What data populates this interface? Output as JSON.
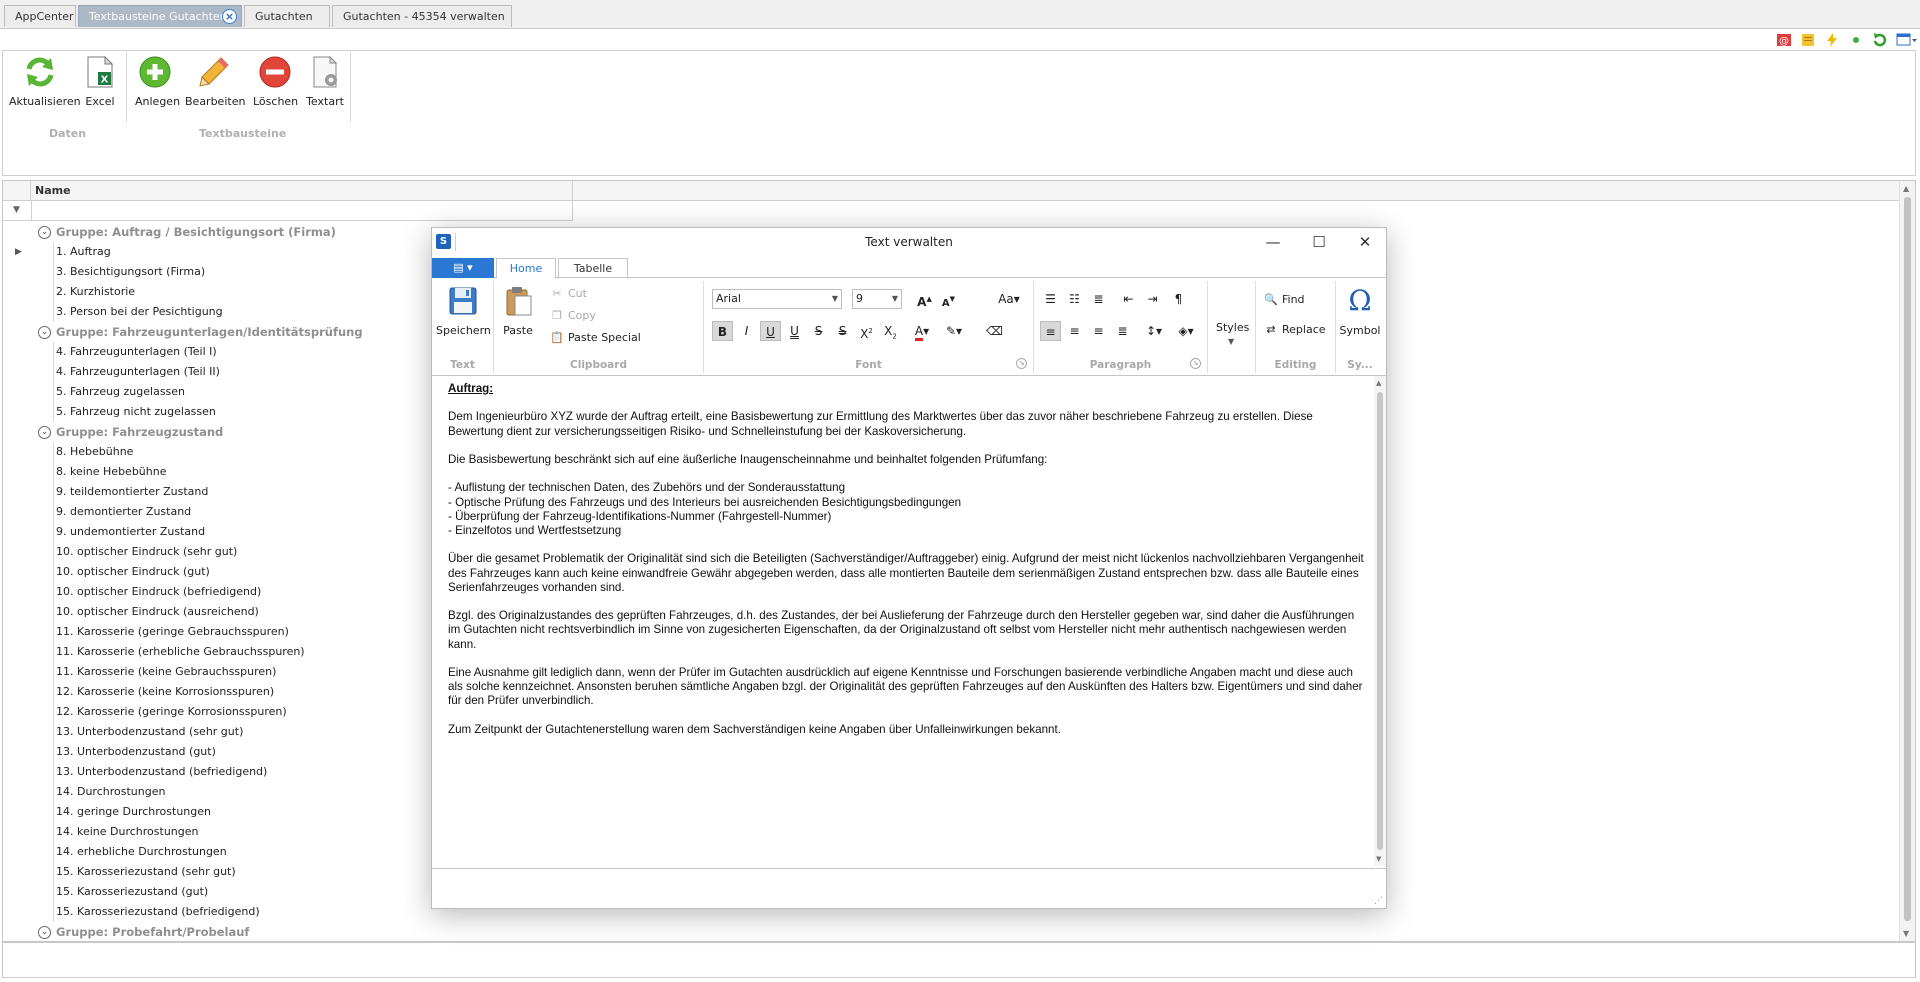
{
  "tabs": [
    {
      "label": "AppCenter",
      "active": false
    },
    {
      "label": "Textbausteine Gutachten",
      "active": true
    },
    {
      "label": "Gutachten",
      "active": false
    },
    {
      "label": "Gutachten - 45354 verwalten",
      "active": false
    }
  ],
  "ribbon": {
    "buttons": [
      "Aktualisieren",
      "Excel",
      "Anlegen",
      "Bearbeiten",
      "Löschen",
      "Textart"
    ],
    "group_daten": "Daten",
    "group_textbausteine": "Textbausteine"
  },
  "grid": {
    "column_name": "Name",
    "rows": [
      {
        "type": "group",
        "label": "Gruppe: Auftrag / Besichtigungsort (Firma)"
      },
      {
        "type": "item",
        "label": "1. Auftrag",
        "current": true
      },
      {
        "type": "item",
        "label": "3. Besichtigungsort (Firma)"
      },
      {
        "type": "item",
        "label": "2. Kurzhistorie"
      },
      {
        "type": "item",
        "label": "3. Person bei der Pesichtigung"
      },
      {
        "type": "group",
        "label": "Gruppe: Fahrzeugunterlagen/Identitätsprüfung"
      },
      {
        "type": "item",
        "label": "4. Fahrzeugunterlagen (Teil I)"
      },
      {
        "type": "item",
        "label": "4. Fahrzeugunterlagen (Teil II)"
      },
      {
        "type": "item",
        "label": "5. Fahrzeug zugelassen"
      },
      {
        "type": "item",
        "label": "5. Fahrzeug nicht zugelassen"
      },
      {
        "type": "group",
        "label": "Gruppe: Fahrzeugzustand"
      },
      {
        "type": "item",
        "label": "8. Hebebühne"
      },
      {
        "type": "item",
        "label": "8. keine Hebebühne"
      },
      {
        "type": "item",
        "label": "9. teildemontierter Zustand"
      },
      {
        "type": "item",
        "label": "9. demontierter Zustand"
      },
      {
        "type": "item",
        "label": "9. undemontierter Zustand"
      },
      {
        "type": "item",
        "label": "10. optischer Eindruck (sehr gut)"
      },
      {
        "type": "item",
        "label": "10. optischer Eindruck (gut)"
      },
      {
        "type": "item",
        "label": "10. optischer Eindruck (befriedigend)"
      },
      {
        "type": "item",
        "label": "10. optischer Eindruck (ausreichend)"
      },
      {
        "type": "item",
        "label": "11. Karosserie (geringe Gebrauchsspuren)"
      },
      {
        "type": "item",
        "label": "11. Karosserie (erhebliche Gebrauchsspuren)"
      },
      {
        "type": "item",
        "label": "11. Karosserie (keine Gebrauchsspuren)"
      },
      {
        "type": "item",
        "label": "12. Karosserie (keine Korrosionsspuren)"
      },
      {
        "type": "item",
        "label": "12. Karosserie (geringe Korrosionsspuren)"
      },
      {
        "type": "item",
        "label": "13. Unterbodenzustand (sehr gut)"
      },
      {
        "type": "item",
        "label": "13. Unterbodenzustand (gut)"
      },
      {
        "type": "item",
        "label": "13. Unterbodenzustand (befriedigend)"
      },
      {
        "type": "item",
        "label": "14. Durchrostungen"
      },
      {
        "type": "item",
        "label": "14. geringe Durchrostungen"
      },
      {
        "type": "item",
        "label": "14. keine Durchrostungen"
      },
      {
        "type": "item",
        "label": "14. erhebliche Durchrostungen"
      },
      {
        "type": "item",
        "label": "15. Karosseriezustand (sehr gut)"
      },
      {
        "type": "item",
        "label": "15. Karosseriezustand (gut)"
      },
      {
        "type": "item",
        "label": "15. Karosseriezustand (befriedigend)"
      },
      {
        "type": "group",
        "label": "Gruppe: Probefahrt/Probelauf"
      }
    ]
  },
  "dialog": {
    "title": "Text verwalten",
    "tabs": {
      "home": "Home",
      "tabelle": "Tabelle"
    },
    "text_group": {
      "speichern": "Speichern",
      "label": "Text"
    },
    "clipboard": {
      "paste": "Paste",
      "cut": "Cut",
      "copy": "Copy",
      "paste_special": "Paste Special",
      "label": "Clipboard"
    },
    "font": {
      "family": "Arial",
      "size": "9",
      "label": "Font"
    },
    "paragraph_label": "Paragraph",
    "styles": "Styles",
    "editing": {
      "find": "Find",
      "replace": "Replace",
      "label": "Editing"
    },
    "symbol": {
      "label": "Symbol",
      "group": "Sy..."
    },
    "document": {
      "heading": "Auftrag:",
      "paragraphs": [
        "Dem Ingenieurbüro XYZ wurde der Auftrag erteilt, eine Basisbewertung zur Ermittlung des Marktwertes über das zuvor näher beschriebene Fahrzeug zu erstellen. Diese Bewertung dient zur versicherungsseitigen Risiko- und Schnelleinstufung bei der Kaskoversicherung.",
        "Die Basisbewertung beschränkt sich auf eine äußerliche Inaugenscheinnahme und beinhaltet folgenden Prüfumfang:",
        "- Auflistung der technischen Daten, des Zubehörs und der Sonderausstattung\n- Optische Prüfung des Fahrzeugs und des Interieurs bei ausreichenden Besichtigungsbedingungen\n- Überprüfung der Fahrzeug-Identifikations-Nummer (Fahrgestell-Nummer)\n- Einzelfotos und Wertfestsetzung",
        "Über die gesamet Problematik der Originalität sind sich die Beteiligten (Sachverständiger/Auftraggeber) einig. Aufgrund der meist nicht lückenlos nachvollziehbaren Vergangenheit des Fahrzeuges kann auch keine einwandfreie Gewähr abgegeben werden, dass alle montierten Bauteile dem serienmäßigen Zustand entsprechen bzw. dass alle Bauteile eines Serienfahrzeuges vorhanden sind.",
        "Bzgl. des Originalzustandes des geprüften Fahrzeuges, d.h. des Zustandes, der bei Auslieferung der Fahrzeuge durch den Hersteller gegeben war, sind daher die Ausführungen im Gutachten nicht rechtsverbindlich im Sinne von zugesicherten Eigenschaften, da der Originalzustand oft selbst vom Hersteller nicht mehr authentisch nachgewiesen werden kann.",
        "Eine Ausnahme gilt lediglich dann, wenn der Prüfer im Gutachten ausdrücklich auf eigene Kenntnisse und Forschungen basierende verbindliche Angaben macht und diese auch als solche kennzeichnet. Ansonsten beruhen sämtliche Angaben bzgl. der Originalität des geprüften Fahrzeuges auf den Auskünften des Halters bzw. Eigentümers und sind daher für den Prüfer unverbindlich.",
        "Zum Zeitpunkt der Gutachtenerstellung waren dem Sachverständigen keine Angaben über Unfalleinwirkungen bekannt."
      ]
    }
  }
}
